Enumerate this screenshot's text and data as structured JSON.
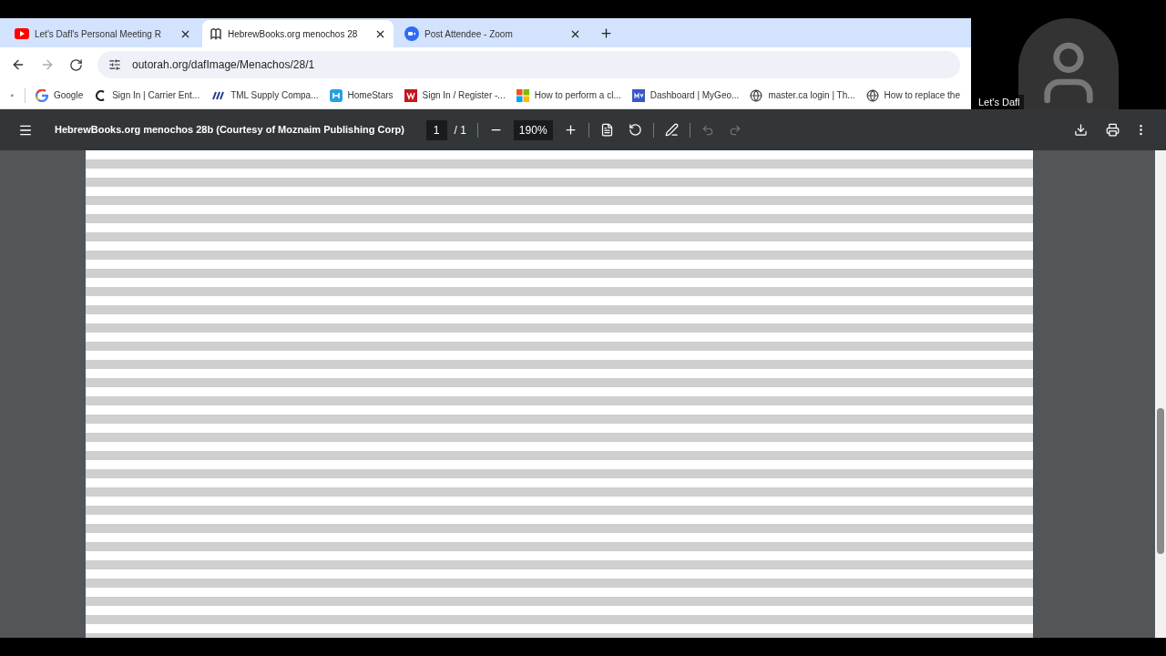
{
  "tabs": [
    {
      "title": "Let's Dafl's Personal Meeting R",
      "kind": "video",
      "selected": false
    },
    {
      "title": "HebrewBooks.org menochos 28",
      "kind": "book",
      "selected": true
    },
    {
      "title": "Post Attendee - Zoom",
      "kind": "zoom",
      "selected": false
    }
  ],
  "address": "outorah.org/dafImage/Menachos/28/1",
  "bookmarks": [
    {
      "title": "Google",
      "kind": "google"
    },
    {
      "title": "Sign In | Carrier Ent...",
      "kind": "ring"
    },
    {
      "title": "TML Supply Compa...",
      "kind": "slant"
    },
    {
      "title": "HomeStars",
      "kind": "house"
    },
    {
      "title": "Sign In / Register -...",
      "kind": "red"
    },
    {
      "title": "How to perform a cl...",
      "kind": "windows"
    },
    {
      "title": "Dashboard | MyGeo...",
      "kind": "blue"
    },
    {
      "title": "master.ca login | Th...",
      "kind": "globe"
    },
    {
      "title": "How to replace the",
      "kind": "globe"
    }
  ],
  "video": {
    "participant_name": "Let's Dafl"
  },
  "pdf_toolbar": {
    "title": "HebrewBooks.org menochos 28b (Courtesy of Moznaim Publishing Corp)",
    "page": "1",
    "page_count": "/ 1",
    "zoom": "190%",
    "undo": {
      "disabled": true
    },
    "redo": {
      "disabled": true
    }
  }
}
